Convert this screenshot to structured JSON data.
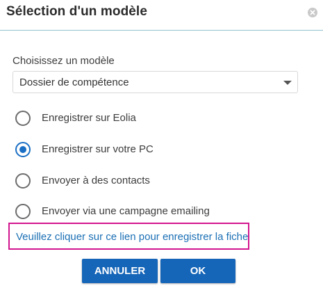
{
  "dialog": {
    "title": "Sélection d'un modèle",
    "close_icon": "close-icon"
  },
  "template_select": {
    "label": "Choisissez un modèle",
    "value": "Dossier de compétence",
    "caret_icon": "chevron-down-icon"
  },
  "options": [
    {
      "label": "Enregistrer sur Eolia",
      "checked": false
    },
    {
      "label": "Enregistrer sur votre PC",
      "checked": true
    },
    {
      "label": "Envoyer à des contacts",
      "checked": false
    },
    {
      "label": "Envoyer via une campagne emailing",
      "checked": false
    }
  ],
  "save_link": {
    "text": "Veuillez cliquer sur ce lien pour enregistrer la fiche"
  },
  "buttons": {
    "cancel_label": "ANNULER",
    "ok_label": "OK"
  },
  "colors": {
    "primary": "#1565b8",
    "link": "#1a6fb4",
    "highlight_border": "#d2148f",
    "header_rule": "#8fc4cf"
  }
}
